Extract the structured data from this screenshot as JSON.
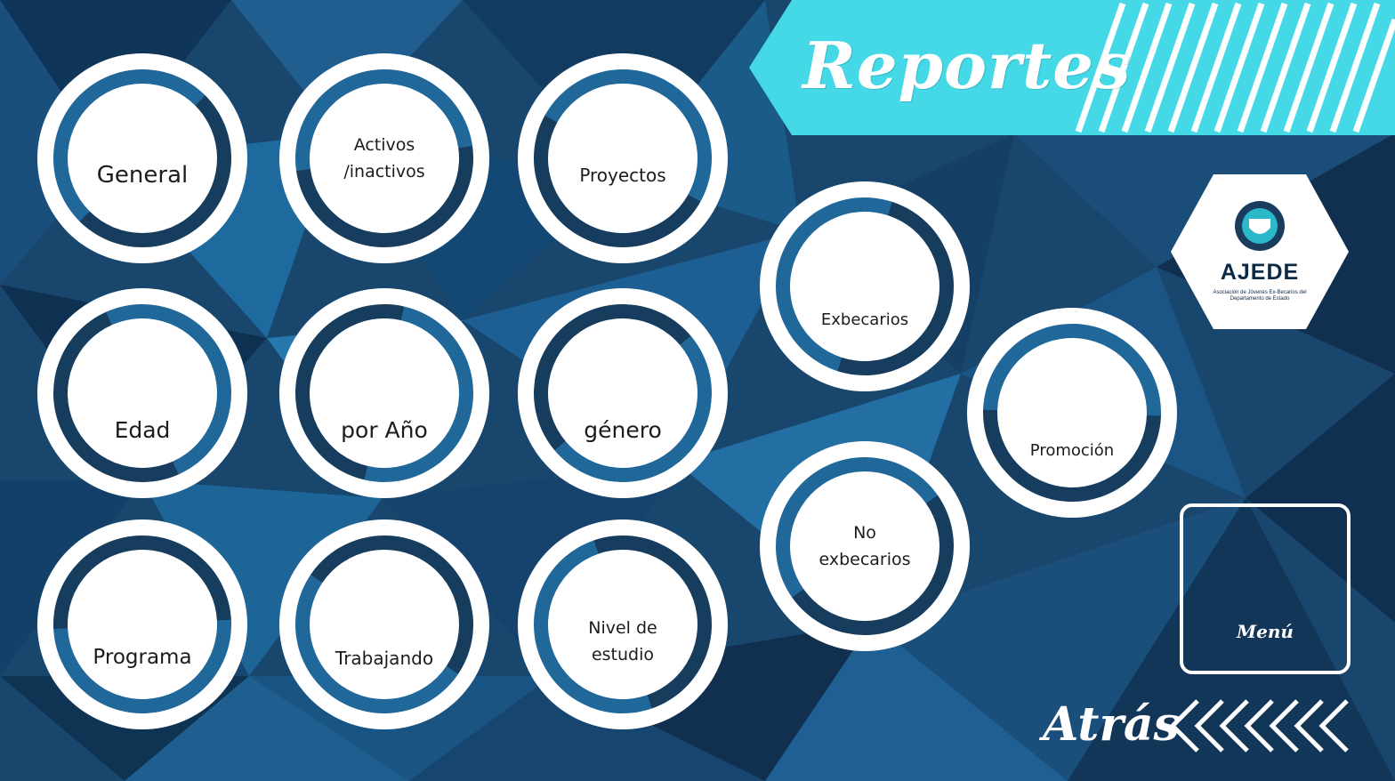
{
  "header": {
    "title": "Reportes"
  },
  "logo": {
    "name": "AJEDE",
    "subtitle": "Asociación de Jóvenes Ex-Becarios del Departamento de Estado"
  },
  "reports": [
    {
      "label": "General",
      "text_lines": [
        "General"
      ]
    },
    {
      "label": "Activos /inactivos",
      "text_lines": [
        "Activos",
        "/inactivos"
      ]
    },
    {
      "label": "Proyectos",
      "text_lines": [
        "Proyectos"
      ]
    },
    {
      "label": "Edad",
      "text_lines": [
        "Edad"
      ]
    },
    {
      "label": "por Año",
      "text_lines": [
        "por Año"
      ]
    },
    {
      "label": "género",
      "text_lines": [
        "género"
      ]
    },
    {
      "label": "Programa",
      "text_lines": [
        "Programa"
      ]
    },
    {
      "label": "Trabajando",
      "text_lines": [
        "Trabajando"
      ]
    },
    {
      "label": "Nivel de estudio",
      "text_lines": [
        "Nivel de",
        "estudio"
      ]
    },
    {
      "label": "Exbecarios",
      "text_lines": [
        "Exbecarios"
      ]
    },
    {
      "label": "No exbecarios",
      "text_lines": [
        "No",
        "exbecarios"
      ]
    },
    {
      "label": "Promoción",
      "text_lines": [
        "Promoción"
      ]
    }
  ],
  "nav": {
    "menu_label": "Menú",
    "back_label": "Atrás"
  },
  "colors": {
    "banner": "#45d9e8",
    "ring_dark": "#163c5e",
    "ring_light": "#20679a",
    "white": "#ffffff"
  }
}
